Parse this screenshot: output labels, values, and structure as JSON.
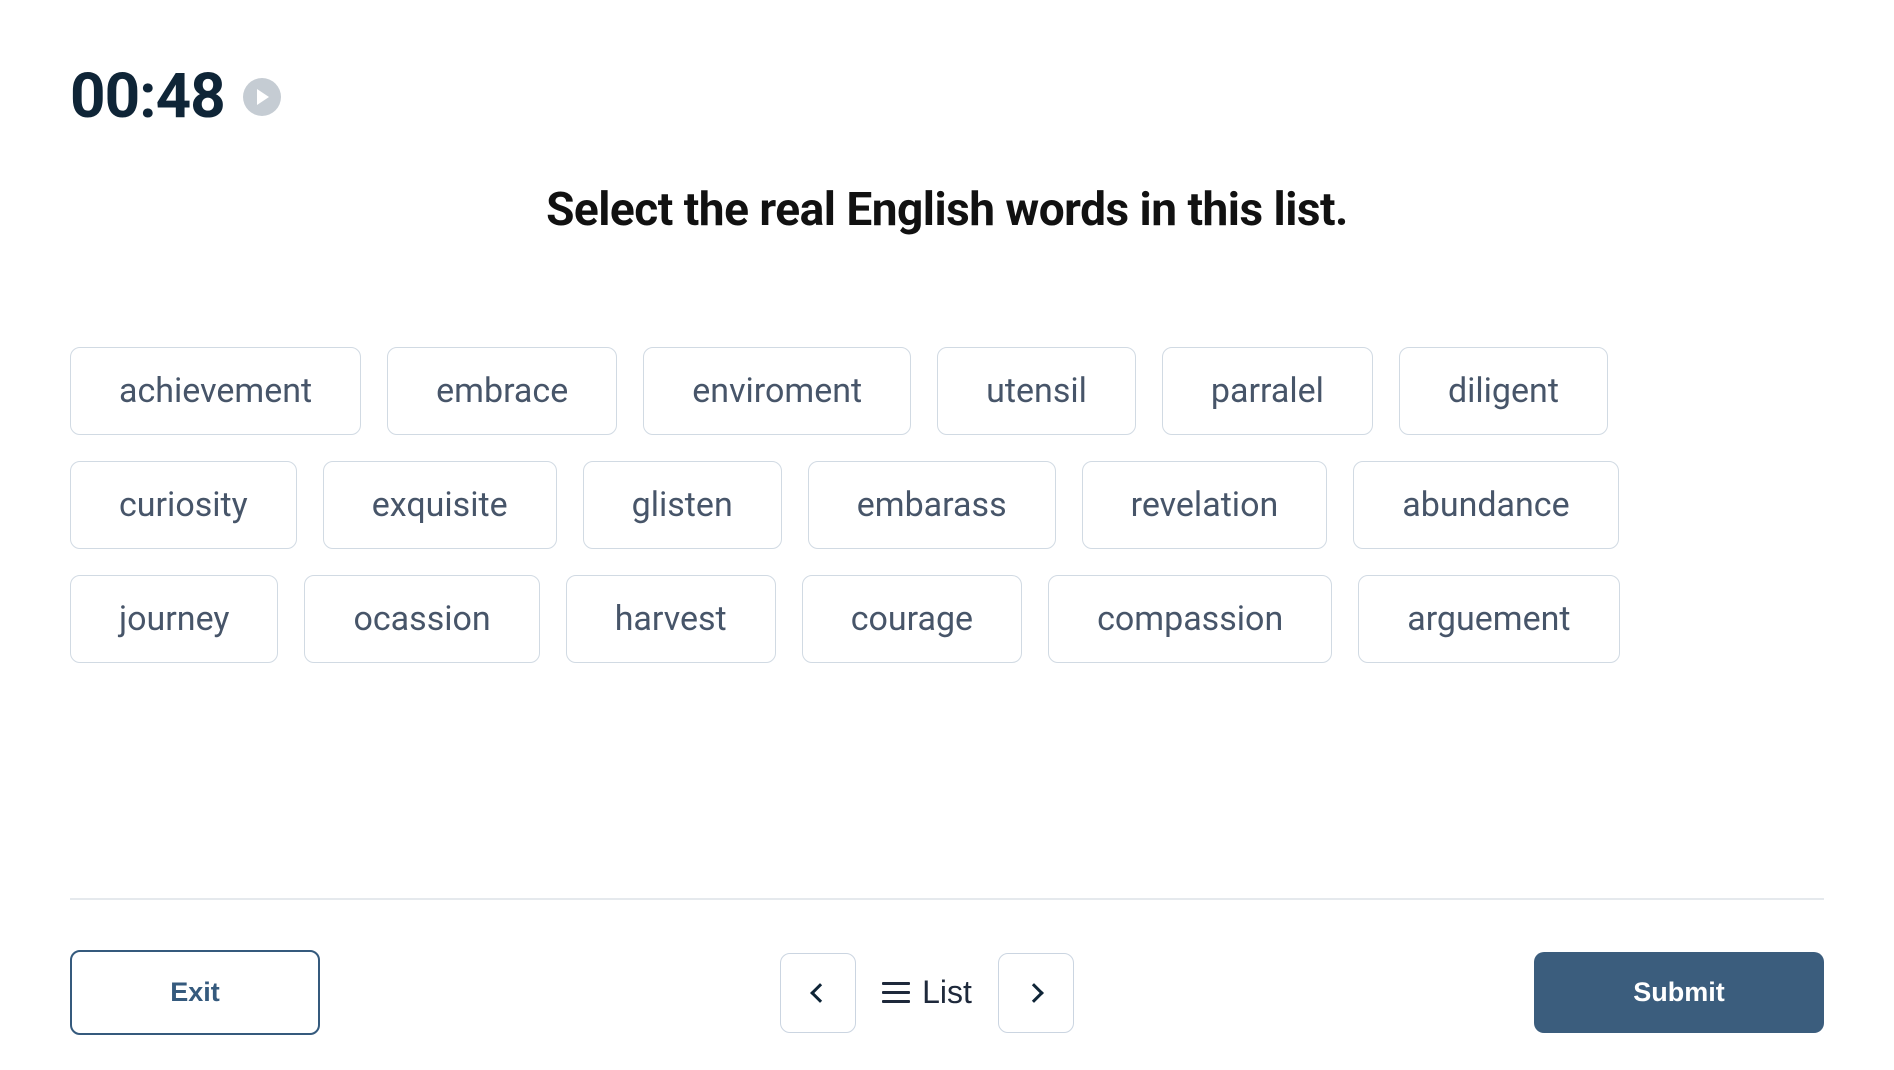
{
  "timer": "00:48",
  "prompt": "Select the real English words in this list.",
  "words": [
    "achievement",
    "embrace",
    "enviroment",
    "utensil",
    "parralel",
    "diligent",
    "curiosity",
    "exquisite",
    "glisten",
    "embarass",
    "revelation",
    "abundance",
    "journey",
    "ocassion",
    "harvest",
    "courage",
    "compassion",
    "arguement"
  ],
  "footer": {
    "exit_label": "Exit",
    "list_label": "List",
    "submit_label": "Submit"
  }
}
